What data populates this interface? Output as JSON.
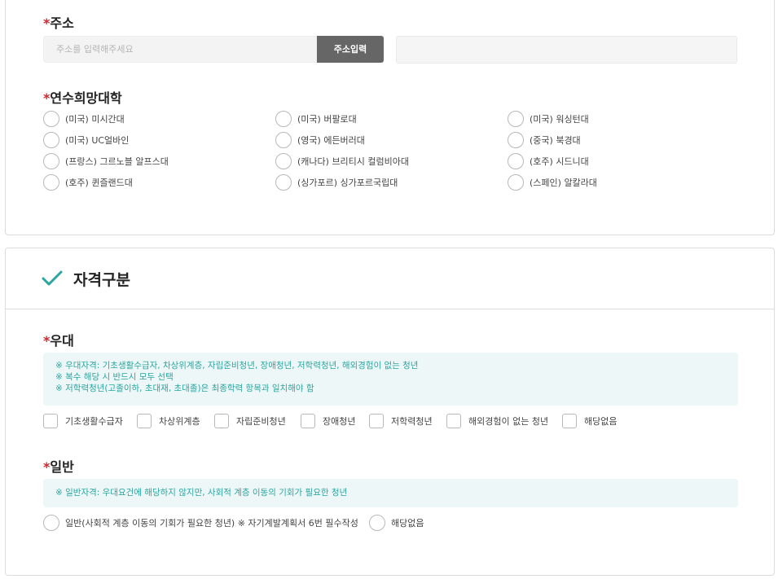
{
  "address": {
    "label": "주소",
    "required_mark": "*",
    "placeholder": "주소를 입력해주세요",
    "button_label": "주소입력"
  },
  "university": {
    "label": "연수희망대학",
    "required_mark": "*",
    "options": [
      "(미국) 미시간대",
      "(미국) 버팔로대",
      "(미국) 워싱턴대",
      "(미국) UC얼바인",
      "(영국) 에든버러대",
      "(중국) 북경대",
      "(프랑스) 그르노블 알프스대",
      "(캐나다) 브리티시 컬럼비아대",
      "(호주) 시드니대",
      "(호주) 퀸즐랜드대",
      "(싱가포르) 싱가포르국립대",
      "(스페인) 알칼라대"
    ]
  },
  "qualification": {
    "section_title": "자격구분",
    "preferential": {
      "label": "우대",
      "required_mark": "*",
      "notes": [
        "※ 우대자격: 기초생활수급자, 차상위계층, 자립준비청년, 장애청년, 저학력청년, 해외경험이 없는 청년",
        "※ 복수 해당 시 반드시 모두 선택",
        "※ 저학력청년(고졸이하, 초대재, 초대졸)은 최종학력 항목과 일치해야 함"
      ],
      "options": [
        "기초생활수급자",
        "차상위계층",
        "자립준비청년",
        "장애청년",
        "저학력청년",
        "해외경험이 없는 청년",
        "해당없음"
      ]
    },
    "general": {
      "label": "일반",
      "required_mark": "*",
      "note": "※ 일반자격: 우대요건에 해당하지 않지만, 사회적 계층 이동의 기회가 필요한 청년",
      "options": [
        "일반(사회적 계층 이동의 기회가 필요한 청년) ※ 자기계발계획서 6번 필수작성",
        "해당없음"
      ]
    }
  },
  "colors": {
    "required": "#d0262d",
    "accent": "#2aa5a0",
    "button": "#666666"
  }
}
